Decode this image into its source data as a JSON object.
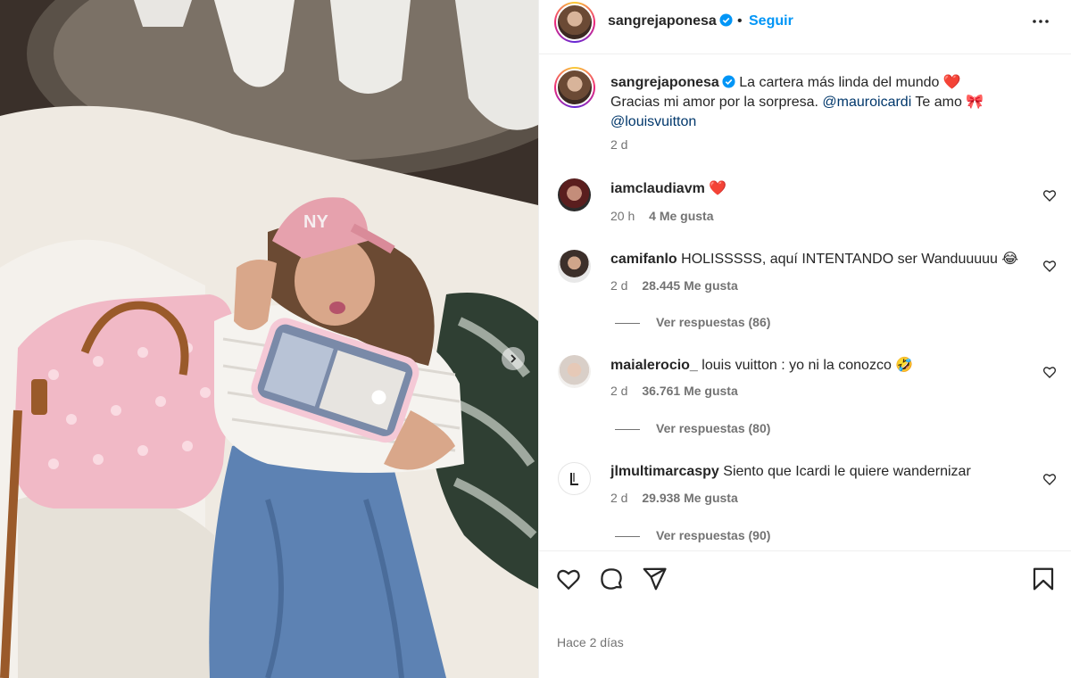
{
  "post": {
    "username": "sangrejaponesa",
    "follow_label": "Seguir",
    "dot": "•",
    "caption_text": "La cartera más linda del mundo",
    "caption_emoji1": "❤️",
    "caption_line2_a": "Gracias mi amor por la sorpresa.",
    "caption_mention1": "@mauroicardi",
    "caption_line2_b": "Te amo",
    "caption_emoji2": "🎀",
    "caption_mention2": "@louisvuitton",
    "caption_time": "2 d",
    "date_label": "Hace 2 días"
  },
  "comments": [
    {
      "username": "iamclaudiavm",
      "text": "",
      "emoji": "❤️",
      "time": "20 h",
      "likes": "4 Me gusta",
      "replies": ""
    },
    {
      "username": "camifanlo",
      "text": "HOLISSSSS, aquí INTENTANDO ser Wanduuuuu",
      "emoji": "😂",
      "time": "2 d",
      "likes": "28.445 Me gusta",
      "replies": "Ver respuestas (86)"
    },
    {
      "username": "maialerocio_",
      "text": "louis vuitton : yo ni la conozco",
      "emoji": "🤣",
      "time": "2 d",
      "likes": "36.761 Me gusta",
      "replies": "Ver respuestas (80)"
    },
    {
      "username": "jlmultimarcaspy",
      "text": "Siento que Icardi le quiere wandernizar",
      "emoji": "",
      "time": "2 d",
      "likes": "29.938 Me gusta",
      "replies": "Ver respuestas (90)"
    }
  ],
  "icons": {
    "verified": "verified-badge-icon",
    "more": "more-options-icon",
    "like": "heart-icon",
    "comment": "comment-icon",
    "share": "share-icon",
    "save": "bookmark-icon",
    "next": "chevron-right-icon"
  },
  "colors": {
    "accent": "#0095f6",
    "mention": "#00376b",
    "secondary_text": "#737373",
    "text": "#262626"
  }
}
